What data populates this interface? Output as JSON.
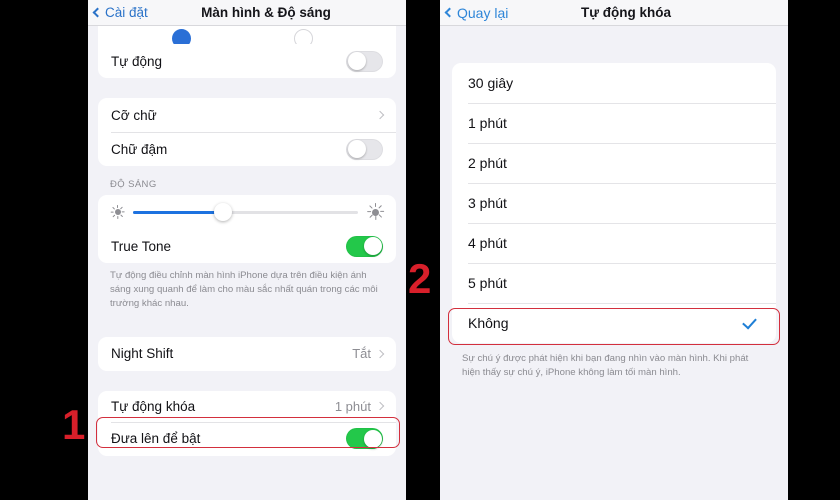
{
  "background_color": "#000000",
  "accent_colors": {
    "ios_blue": "#2a72c8",
    "toggle_green": "#23c84a",
    "slider_blue": "#1d72e0",
    "highlight_red": "#d32f3d",
    "step_red": "#d81f2a",
    "check_blue": "#1f7fd6"
  },
  "left_phone": {
    "navbar": {
      "back_label": "Cài đặt",
      "title": "Màn hình & Độ sáng"
    },
    "auto_row": {
      "label": "Tự động",
      "toggle_state": "off"
    },
    "text_group": [
      {
        "label": "Cỡ chữ",
        "type": "disclosure",
        "value": ""
      },
      {
        "label": "Chữ đậm",
        "type": "toggle",
        "toggle_state": "off"
      }
    ],
    "brightness_section": {
      "header": "ĐỘ SÁNG",
      "slider": {
        "percent": 40,
        "low_icon": "sun-small-icon",
        "high_icon": "sun-large-icon"
      },
      "true_tone": {
        "label": "True Tone",
        "toggle_state": "on"
      },
      "note": "Tự động điều chỉnh màn hình iPhone dựa trên điều kiện ánh sáng xung quanh để làm cho màu sắc nhất quán trong các môi trường khác nhau."
    },
    "night_shift": {
      "label": "Night Shift",
      "value": "Tắt"
    },
    "auto_lock": {
      "label": "Tự động khóa",
      "value": "1 phút"
    },
    "raise_to_wake": {
      "label": "Đưa lên để bật",
      "toggle_state": "on"
    }
  },
  "right_phone": {
    "navbar": {
      "back_label": "Quay lại",
      "title": "Tự động khóa"
    },
    "options": [
      {
        "label": "30 giây",
        "selected": false
      },
      {
        "label": "1 phút",
        "selected": false
      },
      {
        "label": "2 phút",
        "selected": false
      },
      {
        "label": "3 phút",
        "selected": false
      },
      {
        "label": "4 phút",
        "selected": false
      },
      {
        "label": "5 phút",
        "selected": false
      },
      {
        "label": "Không",
        "selected": true
      }
    ],
    "note": "Sự chú ý được phát hiện khi bạn đang nhìn vào màn hình. Khi phát hiện thấy sự chú ý, iPhone không làm tối màn hình."
  },
  "annotations": {
    "step_one": "1",
    "step_two": "2"
  }
}
